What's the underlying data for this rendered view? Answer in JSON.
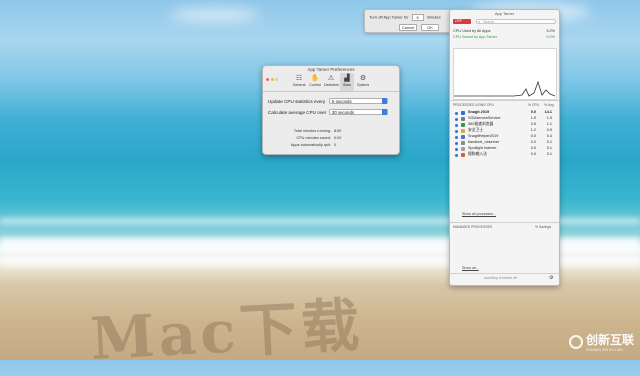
{
  "notification": {
    "prefix": "Turn off App Tamer for",
    "value": "5",
    "suffix": "minutes",
    "cancel": "Cancel",
    "ok": "OK"
  },
  "prefs": {
    "title": "App Tamer Preferences",
    "toolbar": [
      {
        "label": "General",
        "icon": "sliders-icon"
      },
      {
        "label": "Control",
        "icon": "hand-icon"
      },
      {
        "label": "Detection",
        "icon": "warning-icon"
      },
      {
        "label": "Stats",
        "icon": "chart-icon"
      },
      {
        "label": "Options",
        "icon": "gear-icon"
      }
    ],
    "update_label": "Update CPU statistics every",
    "update_value": "5 seconds",
    "average_label": "Calculate average CPU over",
    "average_value": "30 seconds",
    "stats": [
      {
        "label": "Total minutes running:",
        "value": "8:59"
      },
      {
        "label": "CPU minutes saved:",
        "value": "0:00"
      },
      {
        "label": "Apps automatically quit:",
        "value": "0"
      }
    ]
  },
  "panel": {
    "title": "App Tamer",
    "off_label": "OFF",
    "search_placeholder": "Search",
    "cpu_all_label": "CPU Used by All Apps",
    "cpu_all_value": "3.2%",
    "cpu_saved_label": "CPU Saved by App Tamer",
    "cpu_saved_value": "0.0%",
    "processes_header": "PROCESSES USING CPU",
    "col_cpu": "% CPU",
    "col_avg": "% Avg",
    "processes": [
      {
        "name": "Snagit 2019",
        "cpu": "0.0",
        "avg": "14.1",
        "color": "#2e6fd0"
      },
      {
        "name": "SGDaemonService",
        "cpu": "1.9",
        "avg": "1.9",
        "color": "#7a7a7a"
      },
      {
        "name": "360极速浏览器",
        "cpu": "0.5",
        "avg": "1.1",
        "color": "#2f9b46"
      },
      {
        "name": "安全卫士",
        "cpu": "1.2",
        "avg": "0.9",
        "color": "#e4a23a"
      },
      {
        "name": "SnagitHelper2019",
        "cpu": "0.0",
        "avg": "0.4",
        "color": "#3a7bd5"
      },
      {
        "name": "tiandinet_observer",
        "cpu": "0.0",
        "avg": "0.1",
        "color": "#8c8c8c"
      },
      {
        "name": "Spotlight Indexer",
        "cpu": "0.0",
        "avg": "0.1",
        "color": "#9aa0a6"
      },
      {
        "name": "搜狗输入法",
        "cpu": "0.0",
        "avg": "0.1",
        "color": "#e05a3a"
      }
    ],
    "show_all_processes": "Show all processes...",
    "managed_header": "MANAGED PROCESSES",
    "managed_col": "% Savings",
    "show_all": "Show all...",
    "footer_status": "AutoStop is turned off"
  },
  "background": {
    "sand_writing": "Mac下载"
  },
  "watermark": {
    "brand": "创新互联",
    "sub": "CHUANG XIN HU LIAN"
  }
}
